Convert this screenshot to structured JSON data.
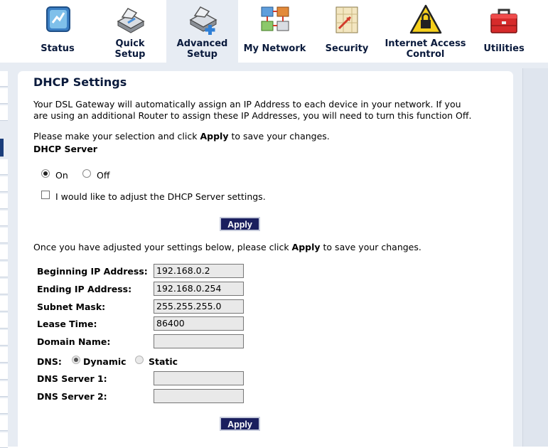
{
  "nav": [
    {
      "label": "Status",
      "icon": "status-icon"
    },
    {
      "label": "Quick\nSetup",
      "icon": "quick-setup-icon"
    },
    {
      "label": "Advanced\nSetup",
      "icon": "advanced-setup-icon",
      "active": true
    },
    {
      "label": "My Network",
      "icon": "my-network-icon"
    },
    {
      "label": "Security",
      "icon": "security-icon"
    },
    {
      "label": "Internet Access\nControl",
      "icon": "internet-access-lock-icon"
    },
    {
      "label": "Utilities",
      "icon": "toolbox-icon"
    }
  ],
  "page": {
    "title": "DHCP Settings",
    "intro_line1": "Your DSL Gateway will automatically assign an IP Address to each device in your network. If you",
    "intro_line2": "are using an additional Router to assign these IP Addresses, you will need to turn this function Off.",
    "selection_prefix": "Please make your selection and click ",
    "selection_bold": "Apply",
    "selection_suffix": " to save your changes.",
    "server_heading": "DHCP Server",
    "radio_on": "On",
    "radio_off": "Off",
    "server_selected": "On",
    "adjust_checkbox_label": "I would like to adjust the DHCP Server settings.",
    "adjust_checked": false,
    "apply_label": "Apply",
    "adjusted_prefix": "Once you have adjusted your settings below, please click ",
    "adjusted_bold": "Apply",
    "adjusted_suffix": " to save your changes."
  },
  "fields": {
    "begin_ip": {
      "label": "Beginning IP Address:",
      "value": "192.168.0.2"
    },
    "end_ip": {
      "label": "Ending IP Address:",
      "value": "192.168.0.254"
    },
    "subnet": {
      "label": "Subnet Mask:",
      "value": "255.255.255.0"
    },
    "lease": {
      "label": "Lease Time:",
      "value": "86400"
    },
    "domain": {
      "label": "Domain Name:",
      "value": ""
    },
    "dns_label": "DNS:",
    "dns_dynamic": "Dynamic",
    "dns_static": "Static",
    "dns_selected": "Dynamic",
    "dns1": {
      "label": "DNS Server 1:",
      "value": ""
    },
    "dns2": {
      "label": "DNS Server 2:",
      "value": ""
    }
  },
  "colors": {
    "nav_text": "#0a1a3c",
    "button_bg": "#1a1f5e",
    "frame_bg": "#e7ecf3"
  }
}
